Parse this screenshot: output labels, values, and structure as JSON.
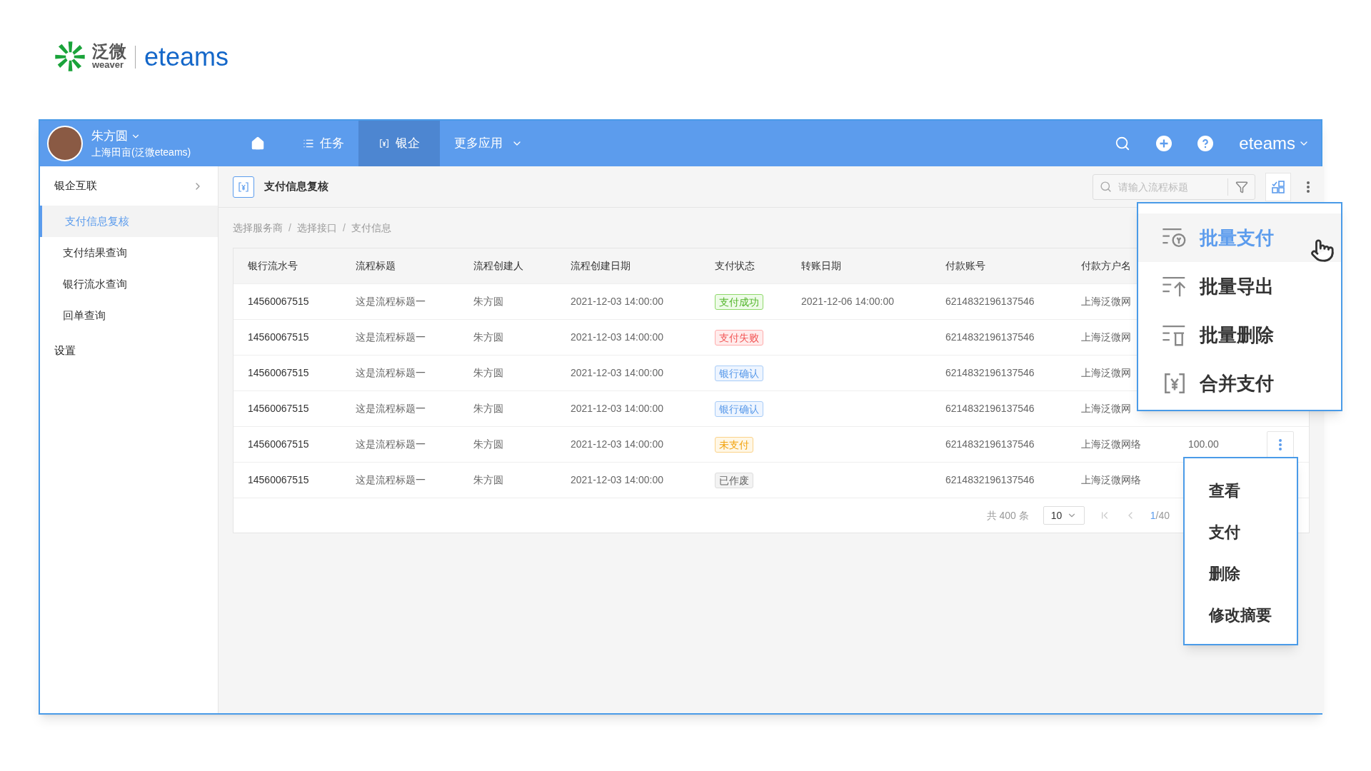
{
  "logo": {
    "cn": "泛微",
    "en": "weaver",
    "product": "eteams"
  },
  "header": {
    "user": {
      "name": "朱方圆",
      "org": "上海田亩(泛微eteams)"
    },
    "nav": [
      {
        "kind": "home",
        "selected": false
      },
      {
        "kind": "list",
        "label": "任务",
        "selected": false
      },
      {
        "kind": "bank",
        "label": "银企",
        "selected": true
      },
      {
        "kind": "more",
        "label": "更多应用",
        "selected": false
      }
    ],
    "brand": "eteams"
  },
  "sidebar": {
    "items": [
      {
        "label": "银企互联",
        "expanded": true,
        "children": [
          {
            "label": "支付信息复核",
            "selected": true
          },
          {
            "label": "支付结果查询",
            "selected": false
          },
          {
            "label": "银行流水查询",
            "selected": false
          },
          {
            "label": "回单查询",
            "selected": false
          }
        ]
      },
      {
        "label": "设置"
      }
    ]
  },
  "page": {
    "title": "支付信息复核",
    "search": {
      "placeholder": "请输入流程标题"
    },
    "breadcrumb": [
      {
        "kind": "link",
        "text": "选择服务商"
      },
      {
        "kind": "separator",
        "text": "/"
      },
      {
        "kind": "link",
        "text": "选择接口"
      },
      {
        "kind": "separator",
        "text": "/"
      },
      {
        "kind": "link",
        "text": "支付信息"
      }
    ]
  },
  "table": {
    "columns": [
      "银行流水号",
      "流程标题",
      "流程创建人",
      "流程创建日期",
      "支付状态",
      "转账日期",
      "付款账号",
      "付款方户名"
    ],
    "rows": [
      {
        "serial": "14560067515",
        "title": "这是流程标题一",
        "creator": "朱方圆",
        "created": "2021-12-03 14:00:00",
        "status": {
          "kind": "success",
          "label": "支付成功"
        },
        "transfer": "2021-12-06 14:00:00",
        "account": "6214832196137546",
        "payer": "上海泛微网"
      },
      {
        "serial": "14560067515",
        "title": "这是流程标题一",
        "creator": "朱方圆",
        "created": "2021-12-03 14:00:00",
        "status": {
          "kind": "failed",
          "label": "支付失败"
        },
        "account": "6214832196137546",
        "payer": "上海泛微网"
      },
      {
        "serial": "14560067515",
        "title": "这是流程标题一",
        "creator": "朱方圆",
        "created": "2021-12-03 14:00:00",
        "status": {
          "kind": "bank",
          "label": "银行确认"
        },
        "account": "6214832196137546",
        "payer": "上海泛微网"
      },
      {
        "serial": "14560067515",
        "title": "这是流程标题一",
        "creator": "朱方圆",
        "created": "2021-12-03 14:00:00",
        "status": {
          "kind": "bank",
          "label": "银行确认"
        },
        "account": "6214832196137546",
        "payer": "上海泛微网"
      },
      {
        "serial": "14560067515",
        "title": "这是流程标题一",
        "creator": "朱方圆",
        "created": "2021-12-03 14:00:00",
        "status": {
          "kind": "unpaid",
          "label": "未支付"
        },
        "account": "6214832196137546",
        "payer": "上海泛微网络",
        "amount": "100.00",
        "actions": true
      },
      {
        "serial": "14560067515",
        "title": "这是流程标题一",
        "creator": "朱方圆",
        "created": "2021-12-03 14:00:00",
        "status": {
          "kind": "void",
          "label": "已作废"
        },
        "account": "6214832196137546",
        "payer": "上海泛微网络"
      }
    ],
    "pagination": {
      "total": "共 400 条",
      "page_size": "10",
      "current": "1",
      "rest": "/40"
    }
  },
  "batch_menu": [
    {
      "kind": "pay",
      "label": "批量支付",
      "selected": true
    },
    {
      "kind": "export",
      "label": "批量导出",
      "selected": false
    },
    {
      "kind": "delete",
      "label": "批量删除",
      "selected": false
    },
    {
      "kind": "merge",
      "label": "合并支付",
      "selected": false
    }
  ],
  "row_menu": [
    "查看",
    "支付",
    "删除",
    "修改摘要"
  ]
}
